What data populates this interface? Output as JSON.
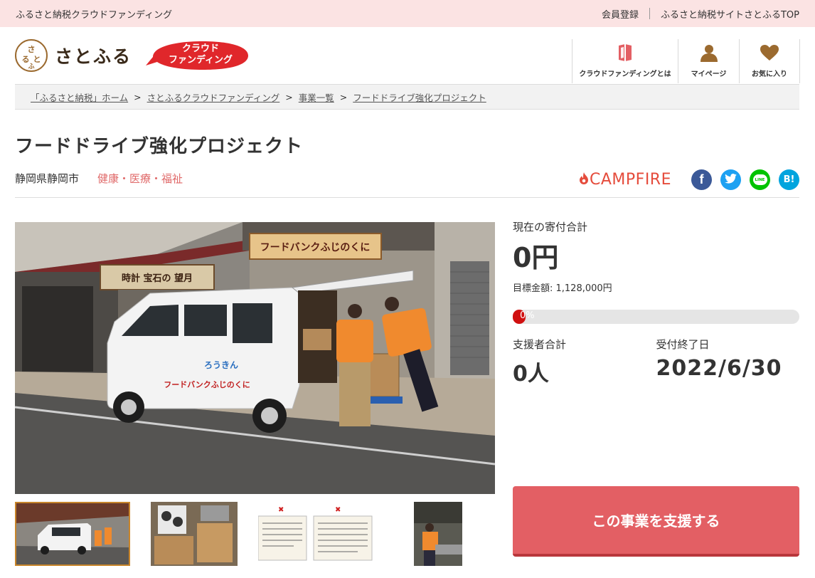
{
  "topbar": {
    "site_label": "ふるさと納税クラウドファンディング",
    "member_link": "会員登録",
    "top_link": "ふるさと納税サイトさとふるTOP"
  },
  "header": {
    "logo_text": "さとふる",
    "logo_mark": "さとふる",
    "cf_badge": "クラウド\nファンディング",
    "nav": [
      {
        "label": "クラウドファンディングとは",
        "icon": "book-icon"
      },
      {
        "label": "マイページ",
        "icon": "person-icon"
      },
      {
        "label": "お気に入り",
        "icon": "heart-icon"
      }
    ]
  },
  "breadcrumb": [
    "「ふるさと納税」ホーム",
    "さとふるクラウドファンディング",
    "事業一覧",
    "フードドライブ強化プロジェクト"
  ],
  "breadcrumb_sep": ">",
  "project": {
    "title": "フードドライブ強化プロジェクト",
    "location": "静岡県静岡市",
    "category": "健康・医療・福祉"
  },
  "share": {
    "campfire": "CAMPFIRE",
    "facebook": "f",
    "twitter": "t",
    "line": "LINE",
    "hatena": "B!"
  },
  "image": {
    "shop_sign": "フードバンクふじのくに",
    "shop_sign2": "時計 宝石の 望月",
    "van_text": "フードバンクふじのくに",
    "van_text2": "ろうきん"
  },
  "stats": {
    "total_label": "現在の寄付合計",
    "total_value": "0円",
    "goal": "目標金額: 1,128,000円",
    "progress": "0%",
    "progress_value": 0,
    "supporters_label": "支援者合計",
    "supporters_value": "0人",
    "deadline_label": "受付終了日",
    "deadline_value": "2022/6/30"
  },
  "support_button": "この事業を支援する",
  "colors": {
    "accent": "#e35f64",
    "topbar": "#fbe3e3",
    "category": "#e06a6a",
    "campfire": "#e54c3c",
    "facebook": "#3b5998",
    "twitter": "#1da1f2",
    "line": "#00c300",
    "hatena": "#00a4de"
  }
}
